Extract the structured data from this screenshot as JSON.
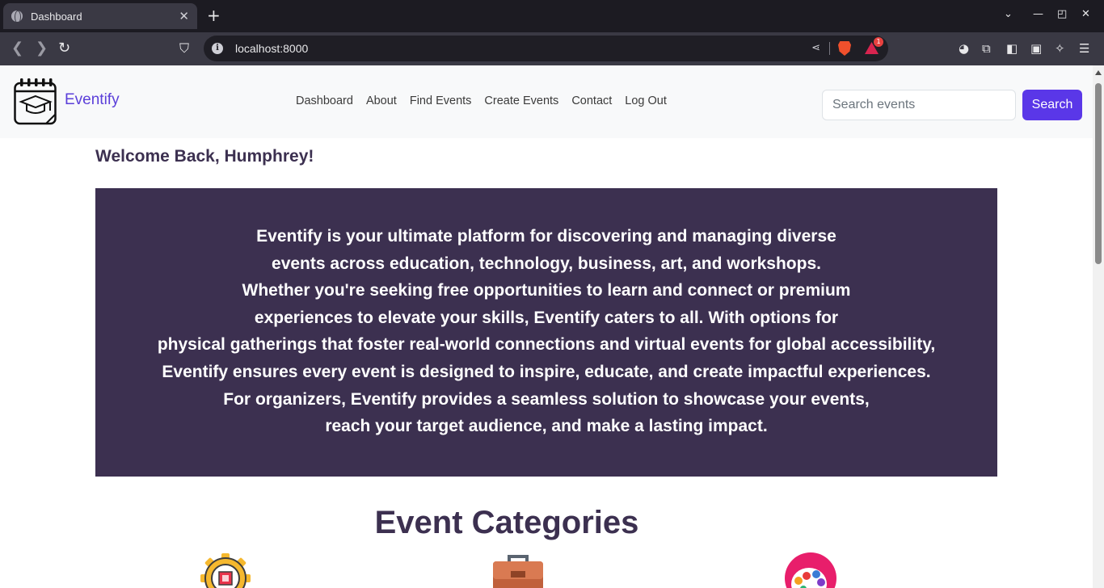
{
  "browser": {
    "tab_title": "Dashboard",
    "url": "localhost:8000",
    "rewards_badge": "1"
  },
  "site": {
    "brand": "Eventify",
    "nav": [
      "Dashboard",
      "About",
      "Find Events",
      "Create Events",
      "Contact",
      "Log Out"
    ],
    "search": {
      "placeholder": "Search events",
      "value": "",
      "button_label": "Search"
    }
  },
  "welcome": "Welcome Back, Humphrey!",
  "hero_lines": [
    "Eventify is your ultimate platform for discovering and managing diverse",
    "events across education, technology, business, art, and workshops.",
    "Whether you're seeking free opportunities to learn and connect or premium",
    "experiences to elevate your skills, Eventify caters to all. With options for",
    "physical gatherings that foster real-world connections and virtual events for global accessibility,",
    "Eventify ensures every event is designed to inspire, educate, and create impactful experiences.",
    "For organizers, Eventify provides a seamless solution to showcase your events,",
    "reach your target audience, and make a lasting impact."
  ],
  "categories": {
    "title": "Event Categories",
    "icons": [
      "technology-gear-chip-icon",
      "business-briefcase-icon",
      "art-palette-icon"
    ]
  },
  "colors": {
    "brand": "#5b3fd9",
    "primary_button": "#5a37e8",
    "hero_background": "#3c3050",
    "header_background": "#f8f9fa"
  }
}
